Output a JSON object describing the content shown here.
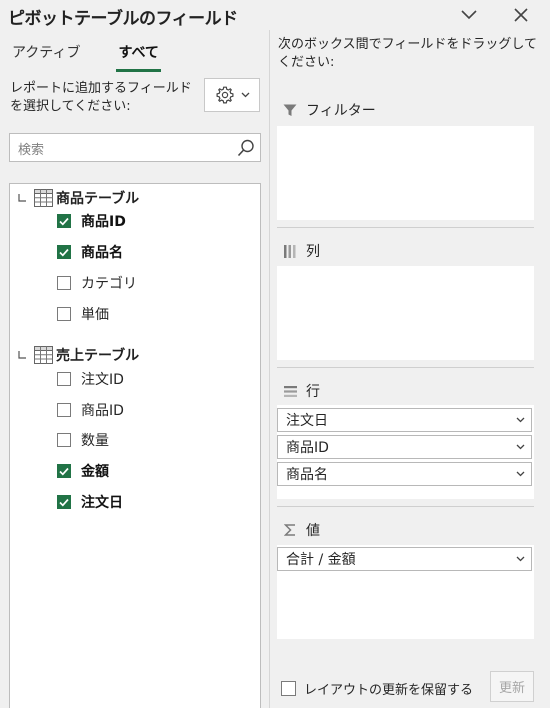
{
  "pane": {
    "title": "ピボットテーブルのフィールド"
  },
  "tabs": [
    {
      "label": "アクティブ",
      "active": false
    },
    {
      "label": "すべて",
      "active": true
    }
  ],
  "left": {
    "add_fields_label": "レポートに追加するフィールドを選択してください:",
    "search_placeholder": "検索"
  },
  "tables": [
    {
      "name": "商品テーブル",
      "fields": [
        {
          "label": "商品ID",
          "checked": true
        },
        {
          "label": "商品名",
          "checked": true
        },
        {
          "label": "カテゴリ",
          "checked": false
        },
        {
          "label": "単価",
          "checked": false
        }
      ]
    },
    {
      "name": "売上テーブル",
      "fields": [
        {
          "label": "注文ID",
          "checked": false
        },
        {
          "label": "商品ID",
          "checked": false
        },
        {
          "label": "数量",
          "checked": false
        },
        {
          "label": "金額",
          "checked": true
        },
        {
          "label": "注文日",
          "checked": true
        }
      ]
    }
  ],
  "right": {
    "drag_label": "次のボックス間でフィールドをドラッグしてください:",
    "areas": {
      "filter": {
        "label": "フィルター",
        "items": []
      },
      "columns": {
        "label": "列",
        "items": []
      },
      "rows": {
        "label": "行",
        "items": [
          "注文日",
          "商品ID",
          "商品名"
        ]
      },
      "values": {
        "label": "値",
        "items": [
          "合計 / 金額"
        ]
      }
    }
  },
  "footer": {
    "defer_label": "レイアウトの更新を保留する",
    "defer_checked": false,
    "update_label": "更新"
  },
  "colors": {
    "accent": "#217346",
    "pane_background": "#f0f0f0"
  }
}
